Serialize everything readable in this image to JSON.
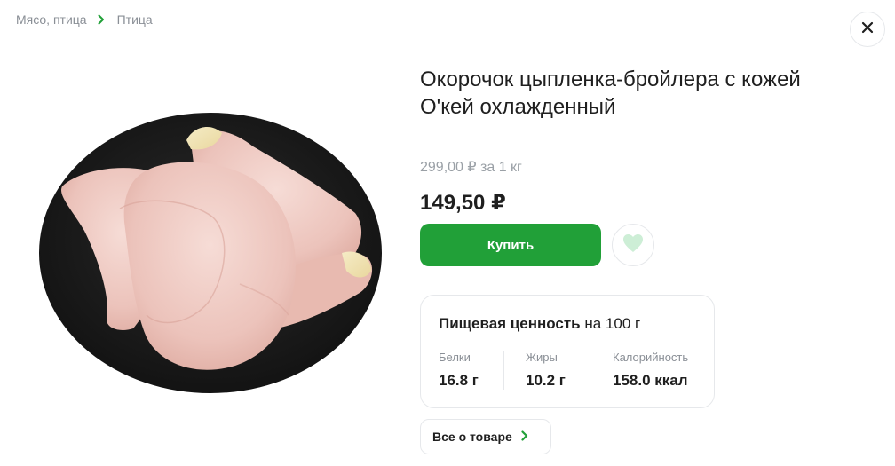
{
  "breadcrumb": {
    "items": [
      "Мясо, птица",
      "Птица"
    ]
  },
  "product": {
    "title_line1": "Окорочок цыпленка-бройлера с кожей",
    "title_line2": "О'кей охлажденный",
    "old_price": "299,00 ₽",
    "old_price_unit": "за 1 кг",
    "price": "149,50 ₽",
    "buy_label": "Купить"
  },
  "nutrition": {
    "title": "Пищевая ценность",
    "per": "на 100 г",
    "items": [
      {
        "label": "Белки",
        "value": "16.8 г"
      },
      {
        "label": "Жиры",
        "value": "10.2 г"
      },
      {
        "label": "Калорийность",
        "value": "158.0 ккал"
      }
    ]
  },
  "about_label": "Все о товаре",
  "colors": {
    "accent": "#21a038",
    "muted": "#8a8f96",
    "heart": "#cdeed6"
  },
  "icons": {
    "close": "close-icon",
    "breadcrumb_separator": "chevron-right-icon",
    "favorite": "heart-icon",
    "about_arrow": "chevron-right-icon"
  }
}
